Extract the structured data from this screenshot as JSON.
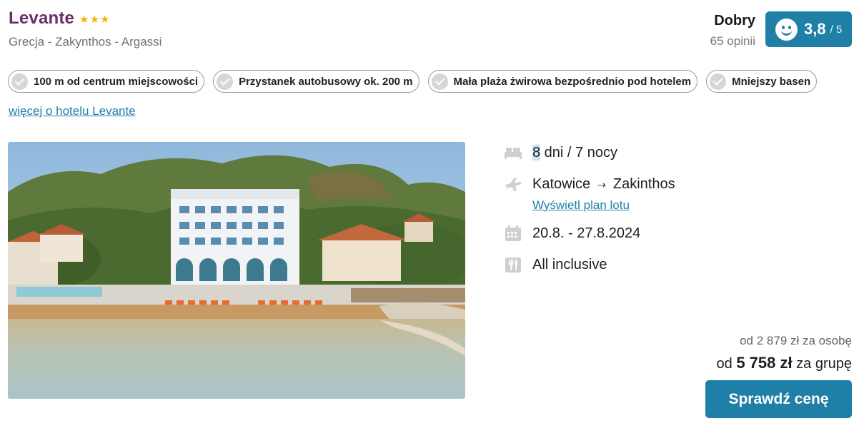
{
  "hotel": {
    "name": "Levante",
    "stars": 3,
    "location": "Grecja - Zakynthos - Argassi",
    "more_link": "więcej o hotelu Levante"
  },
  "rating": {
    "label": "Dobry",
    "reviews": "65 opinii",
    "score": "3,8",
    "max": "/ 5",
    "icon": "smiley-icon"
  },
  "features": [
    {
      "label": "100 m od centrum miejscowości",
      "icon": "check-icon"
    },
    {
      "label": "Przystanek autobusowy ok. 200 m",
      "icon": "check-icon"
    },
    {
      "label": "Mała plaża żwirowa bezpośrednio pod hotelem",
      "icon": "check-icon"
    },
    {
      "label": "Mniejszy basen",
      "icon": "check-icon"
    }
  ],
  "trip": {
    "days_num": "8",
    "days_rest": " dni / 7 nocy",
    "from": "Katowice",
    "arrow": "⇢",
    "to": "Zakinthos",
    "flight_link": "Wyświetl plan lotu",
    "dates": "20.8. - 27.8.2024",
    "board": "All inclusive"
  },
  "price": {
    "per_person": "od 2 879 zł za osobę",
    "group_prefix": "od ",
    "group_amount": "5 758 zł",
    "group_suffix": " za grupę",
    "cta": "Sprawdź cenę"
  },
  "colors": {
    "brand": "#1f7fa6",
    "title": "#6b2d6b",
    "star": "#f4b400"
  }
}
